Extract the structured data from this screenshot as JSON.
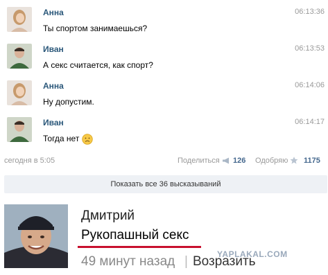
{
  "messages": [
    {
      "name": "Анна",
      "time": "06:13:36",
      "text": "Ты спортом занимаешься?"
    },
    {
      "name": "Иван",
      "time": "06:13:53",
      "text": "А секс считается, как спорт?"
    },
    {
      "name": "Анна",
      "time": "06:14:06",
      "text": "Ну допустим."
    },
    {
      "name": "Иван",
      "time": "06:14:17",
      "text": "Тогда нет"
    }
  ],
  "post_stats": {
    "posted": "сегодня в 5:05",
    "share_label": "Поделиться",
    "share_count": "126",
    "like_label": "Одобряю",
    "like_count": "1175"
  },
  "show_all": "Показать все 36 высказываний",
  "comment": {
    "author": "Дмитрий",
    "text": "Рукопашный секс",
    "time": "49 минут назад",
    "separator": "|",
    "reply": "Возразить"
  },
  "watermark": "YAPLAKAL.COM",
  "colors": {
    "name_link": "#2b587a",
    "count_link": "#45688e",
    "underline": "#c8102e",
    "show_all_bg": "#eef1f5"
  },
  "icons": {
    "share": "megaphone-icon",
    "like": "star-icon",
    "emoji": "sad-face-icon"
  }
}
